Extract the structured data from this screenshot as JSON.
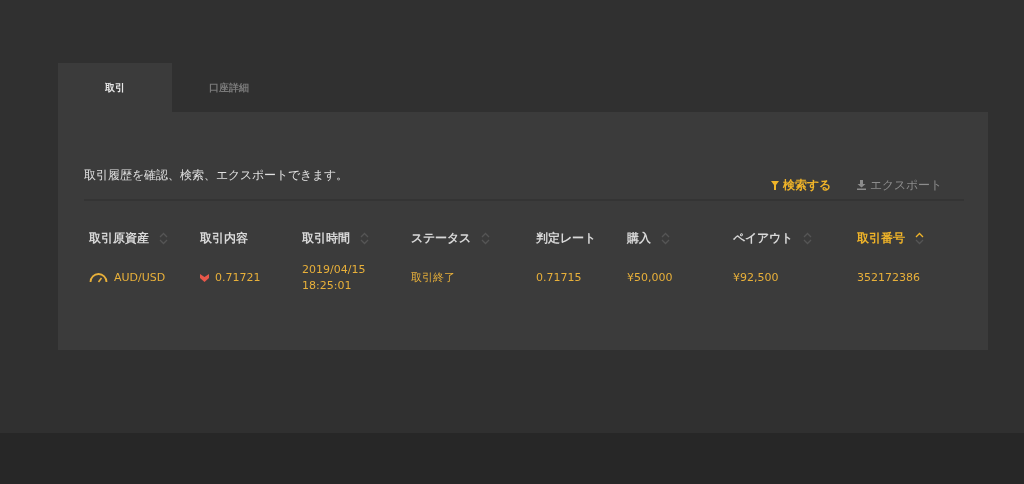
{
  "tabs": [
    {
      "label": "取引",
      "selected": true
    },
    {
      "label": "口座詳細",
      "selected": false
    }
  ],
  "description": "取引履歴を確認、検索、エクスポートできます。",
  "actions": [
    {
      "kind": "filter",
      "label": "検索する",
      "disabled": false
    },
    {
      "kind": "download",
      "label": "エクスポート",
      "disabled": true
    }
  ],
  "table": {
    "columns": [
      {
        "label": "取引原資産",
        "sortable": true,
        "selected": false
      },
      {
        "label": "取引内容",
        "sortable": false,
        "selected": false
      },
      {
        "label": "取引時間",
        "sortable": true,
        "selected": false
      },
      {
        "label": "ステータス",
        "sortable": true,
        "selected": false
      },
      {
        "label": "判定レート",
        "sortable": false,
        "selected": false
      },
      {
        "label": "購入",
        "sortable": true,
        "selected": false
      },
      {
        "label": "ペイアウト",
        "sortable": true,
        "selected": false
      },
      {
        "label": "取引番号",
        "sortable": true,
        "selected": true
      }
    ],
    "rows": [
      {
        "asset": "AUD/USD",
        "falling": true,
        "entry_rate": "0.71721",
        "time": [
          "2019/04/15",
          "18:25:01"
        ],
        "status": "取引終了",
        "closing_rate": "0.71715",
        "purchase": "¥50,000",
        "payout": "¥92,500",
        "trade_number": "352172386"
      }
    ]
  }
}
